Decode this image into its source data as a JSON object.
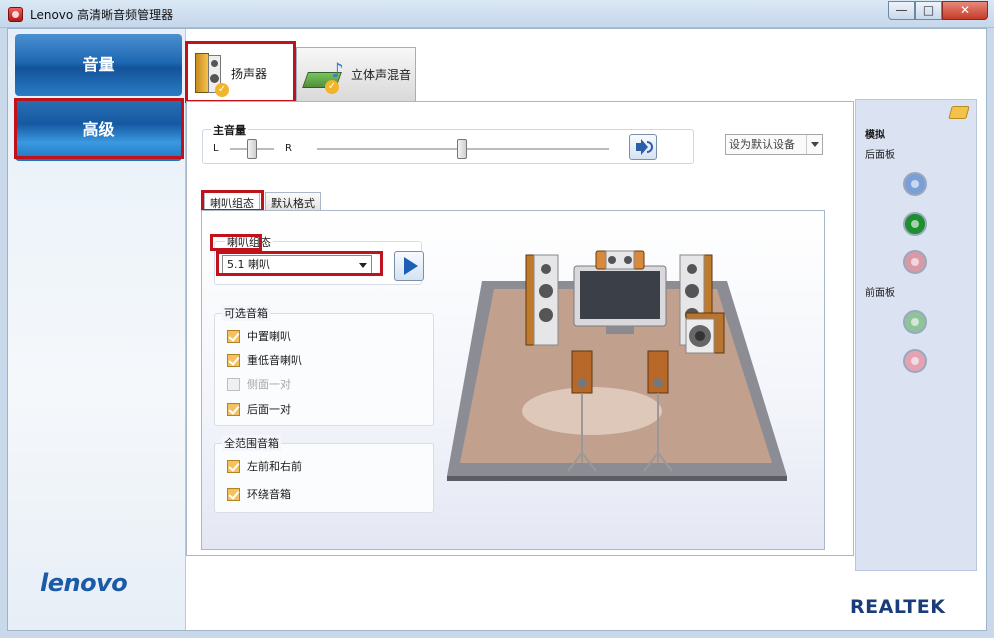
{
  "window": {
    "title": "Lenovo 高清晰音频管理器",
    "buttons": [
      "—",
      "□",
      "✕"
    ]
  },
  "sidebar": {
    "items": [
      {
        "label": "音量",
        "active": false
      },
      {
        "label": "高级",
        "active": true
      }
    ],
    "brand": "lenovo"
  },
  "tabs": [
    {
      "label": "扬声器",
      "active": true
    },
    {
      "label": "立体声混音",
      "active": false
    }
  ],
  "master_volume": {
    "title": "主音量",
    "left_label": "L",
    "right_label": "R",
    "balance": 0.5,
    "level": 0.5
  },
  "default_device": {
    "label": "设为默认设备"
  },
  "inner_tabs": [
    {
      "label": "喇叭组态",
      "active": true
    },
    {
      "label": "默认格式",
      "active": false
    }
  ],
  "speaker_config": {
    "label": "喇叭组态",
    "selected": "5.1 喇叭"
  },
  "optional_speakers": {
    "title": "可选音箱",
    "items": [
      {
        "label": "中置喇叭",
        "checked": true,
        "enabled": true
      },
      {
        "label": "重低音喇叭",
        "checked": true,
        "enabled": true
      },
      {
        "label": "侧面一对",
        "checked": false,
        "enabled": false
      },
      {
        "label": "后面一对",
        "checked": true,
        "enabled": true
      }
    ]
  },
  "full_range": {
    "title": "全范围音箱",
    "items": [
      {
        "label": "左前和右前",
        "checked": true
      },
      {
        "label": "环绕音箱",
        "checked": true
      }
    ]
  },
  "connector_panel": {
    "title": "模拟",
    "back_label": "后面板",
    "front_label": "前面板",
    "back_jacks": [
      {
        "color": "#7a9fd6",
        "name": "line-in"
      },
      {
        "color": "#1d8f2e",
        "name": "line-out"
      },
      {
        "color": "#d99aa8",
        "name": "mic-in"
      }
    ],
    "front_jacks": [
      {
        "color": "#8fc39a",
        "name": "headphone"
      },
      {
        "color": "#e3a3b3",
        "name": "mic"
      }
    ]
  },
  "brand_right": "REALTEK",
  "colors": {
    "accent": "#1f69b3",
    "highlight": "#c1121c"
  }
}
